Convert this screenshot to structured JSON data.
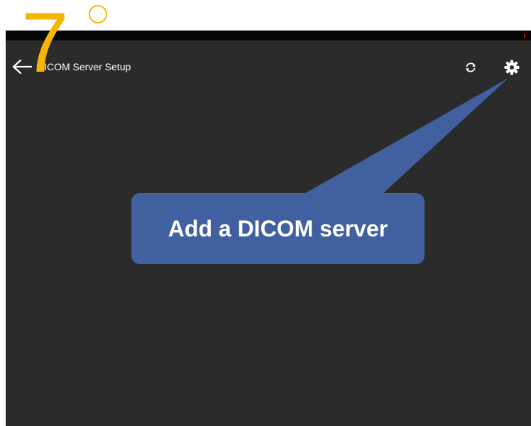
{
  "tutorial": {
    "step_number": "7",
    "callout_text": "Add a DICOM server",
    "accent_color": "#f7b500",
    "callout_color": "#40609f"
  },
  "app": {
    "header": {
      "title": "DICOM Server Setup",
      "back_icon": "arrow-left-icon",
      "sync_icon": "refresh-icon",
      "settings_icon": "gear-icon"
    },
    "background_color": "#2b2b2b",
    "status_bar_color": "#050505"
  }
}
